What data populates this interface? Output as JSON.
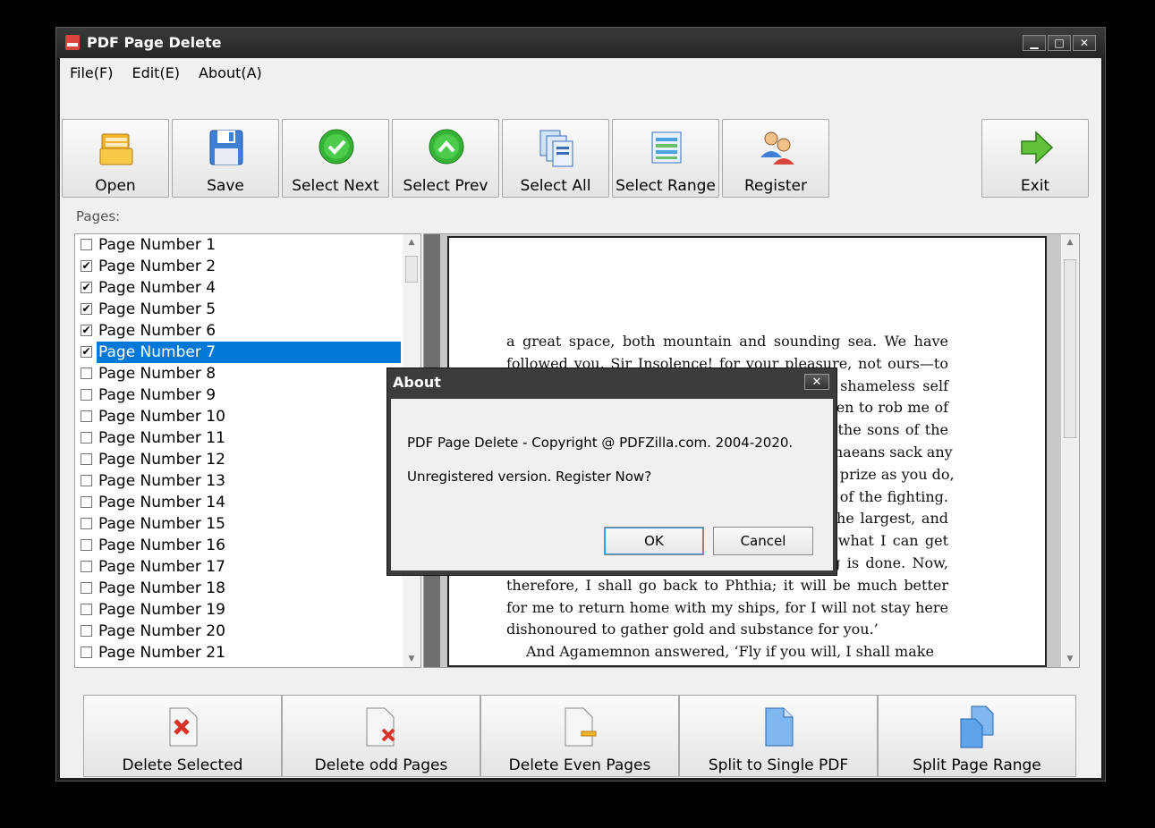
{
  "window": {
    "title": "PDF Page Delete",
    "controls": [
      "▁",
      "□",
      "✕"
    ]
  },
  "menu": [
    {
      "label": "File(F)"
    },
    {
      "label": "Edit(E)"
    },
    {
      "label": "About(A)"
    }
  ],
  "toolbar": [
    {
      "label": "Open",
      "icon": "folder-icon"
    },
    {
      "label": "Save",
      "icon": "floppy-disk-icon"
    },
    {
      "label": "Select Next",
      "icon": "check-circle-icon"
    },
    {
      "label": "Select Prev",
      "icon": "up-arrow-circle-icon"
    },
    {
      "label": "Select All",
      "icon": "pages-stack-icon"
    },
    {
      "label": "Select Range",
      "icon": "grid-range-icon"
    },
    {
      "label": "Register",
      "icon": "users-icon"
    },
    {
      "label": "Exit",
      "icon": "exit-arrow-icon"
    }
  ],
  "pages_label": "Pages:",
  "pages": [
    {
      "label": "Page Number 1",
      "checked": false,
      "selected": false
    },
    {
      "label": "Page Number 2",
      "checked": true,
      "selected": false
    },
    {
      "label": "Page Number 4",
      "checked": true,
      "selected": false
    },
    {
      "label": "Page Number 5",
      "checked": true,
      "selected": false
    },
    {
      "label": "Page Number 6",
      "checked": true,
      "selected": false
    },
    {
      "label": "Page Number 7",
      "checked": true,
      "selected": true
    },
    {
      "label": "Page Number 8",
      "checked": false,
      "selected": false
    },
    {
      "label": "Page Number 9",
      "checked": false,
      "selected": false
    },
    {
      "label": "Page Number 10",
      "checked": false,
      "selected": false
    },
    {
      "label": "Page Number 11",
      "checked": false,
      "selected": false
    },
    {
      "label": "Page Number 12",
      "checked": false,
      "selected": false
    },
    {
      "label": "Page Number 13",
      "checked": false,
      "selected": false
    },
    {
      "label": "Page Number 14",
      "checked": false,
      "selected": false
    },
    {
      "label": "Page Number 15",
      "checked": false,
      "selected": false
    },
    {
      "label": "Page Number 16",
      "checked": false,
      "selected": false
    },
    {
      "label": "Page Number 17",
      "checked": false,
      "selected": false
    },
    {
      "label": "Page Number 18",
      "checked": false,
      "selected": false
    },
    {
      "label": "Page Number 19",
      "checked": false,
      "selected": false
    },
    {
      "label": "Page Number 20",
      "checked": false,
      "selected": false
    },
    {
      "label": "Page Number 21",
      "checked": false,
      "selected": false
    }
  ],
  "preview": {
    "lines": [
      "a great space, both mountain and sounding sea. We have",
      "followed you, Sir Insolence! for your pleasure, not ours—to",
      "gain satisfaction from the Trojans for your shameless self",
      "and for Menelaus. You forget this, and threaten to rob me of",
      "the prize for which I have toiled, and which the sons of the",
      "Achaeans have given me. Never when the Achaeans sack any",
      "rich city of the Trojans do I receive so good a prize as you do,",
      "though it is my hands that do the better part of the fighting.",
      "When the sharing comes, your share is far the largest, and",
      "I, forsooth, must go back to my ships, take what I can get",
      "and be thankful, when my labour of fighting is done. Now,",
      "therefore, I shall go back to Phthia; it will be much better",
      "for me to return home with my ships, for I will not stay here",
      "dishonoured to gather gold and substance for you.’",
      "And Agamemnon answered, ‘Fly if you will, I shall make"
    ]
  },
  "about_dialog": {
    "title": "About",
    "close": "✕",
    "copyright": "PDF Page Delete - Copyright @ PDFZilla.com. 2004-2020.",
    "message": "Unregistered version. Register Now?",
    "ok": "OK",
    "cancel": "Cancel"
  },
  "bottom_buttons": [
    {
      "label": "Delete Selected",
      "icon": "delete-selected-icon"
    },
    {
      "label": "Delete odd Pages",
      "icon": "delete-odd-icon"
    },
    {
      "label": "Delete Even Pages",
      "icon": "delete-even-icon"
    },
    {
      "label": "Split to Single PDF",
      "icon": "split-single-icon"
    },
    {
      "label": "Split Page Range",
      "icon": "split-range-icon"
    }
  ]
}
